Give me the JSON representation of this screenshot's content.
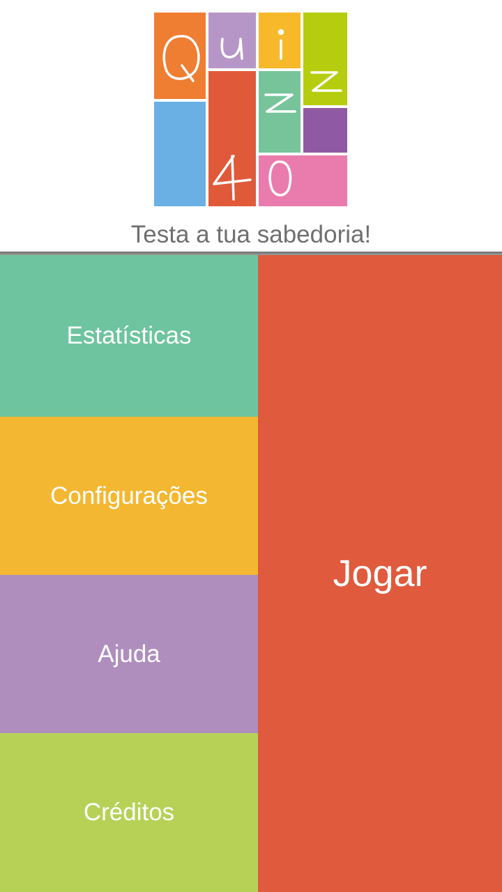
{
  "app": {
    "logo_letters": {
      "q": "Q",
      "u": "u",
      "i": "i",
      "z1": "z",
      "z2": "z",
      "n4": "4",
      "n0": "0"
    },
    "tagline": "Testa a tua sabedoria!"
  },
  "menu": {
    "statistics": "Estatísticas",
    "settings": "Configurações",
    "help": "Ajuda",
    "credits": "Créditos",
    "play": "Jogar"
  },
  "colors": {
    "statistics": "#6dc49e",
    "settings": "#f4b731",
    "help": "#af8dbd",
    "credits": "#b7d157",
    "play": "#e05a3d",
    "logo_orange": "#ef7d32",
    "logo_lilac": "#b696c7",
    "logo_yellow": "#f7b92a",
    "logo_lime": "#b6cd0f",
    "logo_blue": "#6ab0e4",
    "logo_red": "#e05a3a",
    "logo_green": "#77c49b",
    "logo_purple": "#8f5aa3",
    "logo_pink": "#e97cad"
  }
}
